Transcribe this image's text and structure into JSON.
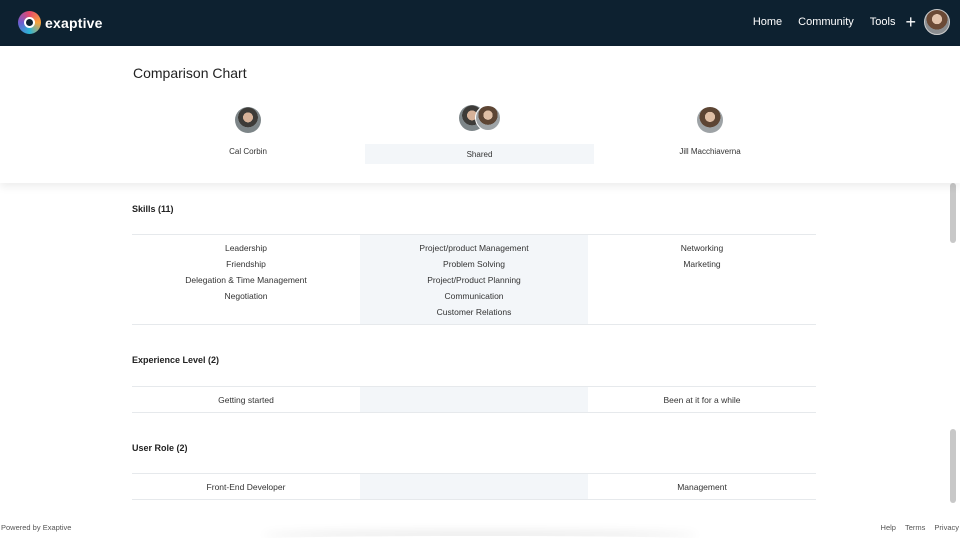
{
  "navbar": {
    "brand": "exaptive",
    "links": [
      "Home",
      "Community",
      "Tools"
    ],
    "add_icon": "plus-icon"
  },
  "header": {
    "title": "Comparison Chart",
    "left_person": "Cal Corbin",
    "shared_label": "Shared",
    "right_person": "Jill Macchiaverna"
  },
  "sections": {
    "skills": {
      "title": "Skills (11)",
      "left": [
        "Leadership",
        "Friendship",
        "Delegation & Time Management",
        "Negotiation"
      ],
      "shared": [
        "Project/product Management",
        "Problem Solving",
        "Project/Product Planning",
        "Communication",
        "Customer Relations"
      ],
      "right": [
        "Networking",
        "Marketing"
      ]
    },
    "experience": {
      "title": "Experience Level (2)",
      "left": "Getting started",
      "shared": "",
      "right": "Been at it for a while"
    },
    "role": {
      "title": "User Role (2)",
      "left": "Front-End Developer",
      "shared": "",
      "right": "Management"
    }
  },
  "footer": {
    "powered": "Powered by Exaptive",
    "links": [
      "Help",
      "Terms",
      "Privacy"
    ]
  },
  "colors": {
    "navbar_bg": "#0d2130",
    "shared_bg": "#f3f6f9"
  }
}
